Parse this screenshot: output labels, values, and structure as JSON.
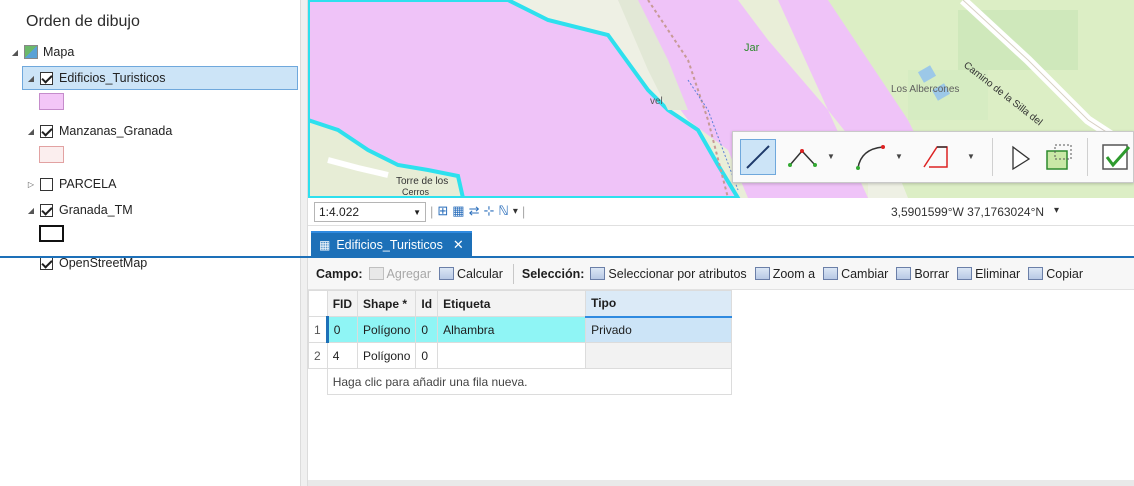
{
  "contents": {
    "title": "Orden de dibujo",
    "map_name": "Mapa",
    "layers": [
      {
        "name": "Edificios_Turisticos",
        "checked": true,
        "symbol_color": "#f3c6f7",
        "symbol_border": "#c58ccb"
      },
      {
        "name": "Manzanas_Granada",
        "checked": true,
        "symbol_color": "#fbeeee",
        "symbol_border": "#e2a2a2"
      },
      {
        "name": "PARCELA",
        "checked": false
      },
      {
        "name": "Granada_TM",
        "checked": true,
        "symbol_color": "#ffffff",
        "symbol_border": "#111111"
      },
      {
        "name": "OpenStreetMap",
        "checked": true
      }
    ]
  },
  "map": {
    "labels": {
      "jar": "Jar",
      "albercones": "Los Albercones",
      "road": "Camino de la Silla del",
      "torre": "Torre de los",
      "torre2": "Cerros",
      "vel": "vel"
    },
    "colors": {
      "polygon_fill": "#efc3f8",
      "polygon_outline": "#2ee0ee",
      "base": "#eef0e4"
    }
  },
  "statusbar": {
    "scale": "1:4.022",
    "coordinates": "3,5901599°W 37,1763024°N"
  },
  "table_tab": {
    "label": "Edificios_Turisticos"
  },
  "table_toolbar": {
    "campo": "Campo:",
    "agregar": "Agregar",
    "calcular": "Calcular",
    "seleccion": "Selección:",
    "seleccionar_atributos": "Seleccionar por atributos",
    "zoom_a": "Zoom a",
    "cambiar": "Cambiar",
    "borrar": "Borrar",
    "eliminar": "Eliminar",
    "copiar": "Copiar"
  },
  "attribute_table": {
    "headers": [
      "FID",
      "Shape *",
      "Id",
      "Etiqueta",
      "Tipo"
    ],
    "rows": [
      {
        "index": "1",
        "fid": "0",
        "shape": "Polígono",
        "id": "0",
        "etiqueta": "Alhambra",
        "tipo": "Privado"
      },
      {
        "index": "2",
        "fid": "4",
        "shape": "Polígono",
        "id": "0",
        "etiqueta": "",
        "tipo": ""
      }
    ],
    "new_row_hint": "Haga clic para añadir una fila nueva."
  }
}
